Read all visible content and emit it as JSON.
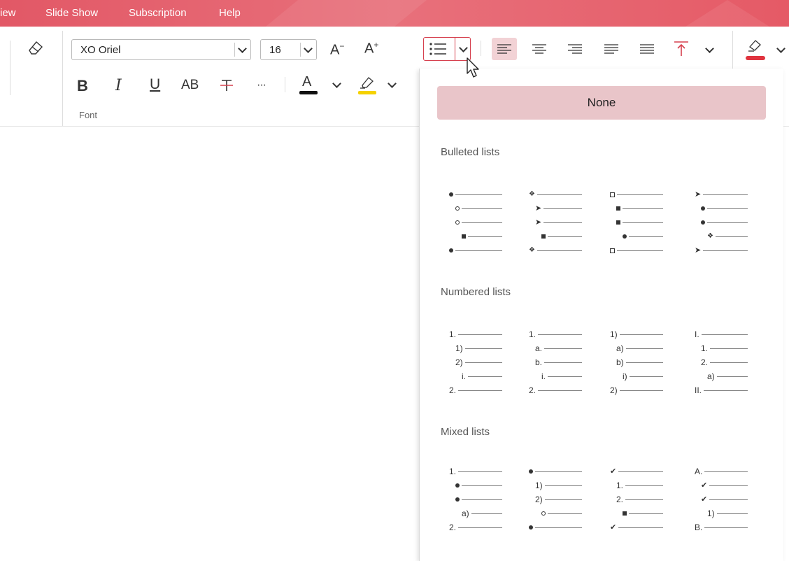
{
  "menubar": {
    "items": [
      "iew",
      "Slide Show",
      "Subscription",
      "Help"
    ]
  },
  "ribbon": {
    "font_name": "XO Oriel",
    "font_size": "16",
    "grow_font_glyph": "A",
    "shrink_font_glyph": "A",
    "bold": "B",
    "italic": "I",
    "underline": "U",
    "caps": "AB",
    "more": "···",
    "font_color_glyph": "A",
    "group_label": "Font",
    "colors": {
      "font_color": "#111111",
      "highlight": "#f5d200",
      "fill": "#e0343f",
      "accent": "#d6404e"
    }
  },
  "dropdown": {
    "none_label": "None",
    "sections": {
      "bulleted": "Bulleted lists",
      "numbered": "Numbered lists",
      "mixed": "Mixed lists"
    },
    "bulleted_samples": [
      [
        {
          "m": "dot",
          "lvl": 0
        },
        {
          "m": "circle",
          "lvl": 1
        },
        {
          "m": "circle",
          "lvl": 1
        },
        {
          "m": "square",
          "lvl": 2
        },
        {
          "m": "dot",
          "lvl": 0
        }
      ],
      [
        {
          "m": "diamond",
          "lvl": 0
        },
        {
          "m": "arrow",
          "lvl": 1
        },
        {
          "m": "arrow",
          "lvl": 1
        },
        {
          "m": "square",
          "lvl": 2
        },
        {
          "m": "diamond",
          "lvl": 0
        }
      ],
      [
        {
          "m": "osquare",
          "lvl": 0
        },
        {
          "m": "square",
          "lvl": 1
        },
        {
          "m": "square",
          "lvl": 1
        },
        {
          "m": "dot",
          "lvl": 2
        },
        {
          "m": "osquare",
          "lvl": 0
        }
      ],
      [
        {
          "m": "arrow",
          "lvl": 0
        },
        {
          "m": "dot",
          "lvl": 1
        },
        {
          "m": "dot",
          "lvl": 1
        },
        {
          "m": "diamond",
          "lvl": 2
        },
        {
          "m": "arrow",
          "lvl": 0
        }
      ]
    ],
    "numbered_samples": [
      [
        {
          "t": "1.",
          "lvl": 0
        },
        {
          "t": "1)",
          "lvl": 1
        },
        {
          "t": "2)",
          "lvl": 1
        },
        {
          "t": "i.",
          "lvl": 2
        },
        {
          "t": "2.",
          "lvl": 0
        }
      ],
      [
        {
          "t": "1.",
          "lvl": 0
        },
        {
          "t": "a.",
          "lvl": 1
        },
        {
          "t": "b.",
          "lvl": 1
        },
        {
          "t": "i.",
          "lvl": 2
        },
        {
          "t": "2.",
          "lvl": 0
        }
      ],
      [
        {
          "t": "1)",
          "lvl": 0
        },
        {
          "t": "a)",
          "lvl": 1
        },
        {
          "t": "b)",
          "lvl": 1
        },
        {
          "t": "i)",
          "lvl": 2
        },
        {
          "t": "2)",
          "lvl": 0
        }
      ],
      [
        {
          "t": "I.",
          "lvl": 0
        },
        {
          "t": "1.",
          "lvl": 1
        },
        {
          "t": "2.",
          "lvl": 1
        },
        {
          "t": "a)",
          "lvl": 2
        },
        {
          "t": "II.",
          "lvl": 0
        }
      ]
    ],
    "mixed_samples": [
      [
        {
          "t": "1.",
          "lvl": 0
        },
        {
          "m": "dot",
          "lvl": 1
        },
        {
          "m": "dot",
          "lvl": 1
        },
        {
          "t": "a)",
          "lvl": 2
        },
        {
          "t": "2.",
          "lvl": 0
        }
      ],
      [
        {
          "m": "dot",
          "lvl": 0
        },
        {
          "t": "1)",
          "lvl": 1
        },
        {
          "t": "2)",
          "lvl": 1
        },
        {
          "m": "circle",
          "lvl": 2
        },
        {
          "m": "dot",
          "lvl": 0
        }
      ],
      [
        {
          "m": "check",
          "lvl": 0
        },
        {
          "t": "1.",
          "lvl": 1
        },
        {
          "t": "2.",
          "lvl": 1
        },
        {
          "m": "square",
          "lvl": 2
        },
        {
          "m": "check",
          "lvl": 0
        }
      ],
      [
        {
          "t": "A.",
          "lvl": 0
        },
        {
          "m": "check",
          "lvl": 1
        },
        {
          "m": "check",
          "lvl": 1
        },
        {
          "t": "1)",
          "lvl": 2
        },
        {
          "t": "B.",
          "lvl": 0
        }
      ]
    ]
  }
}
